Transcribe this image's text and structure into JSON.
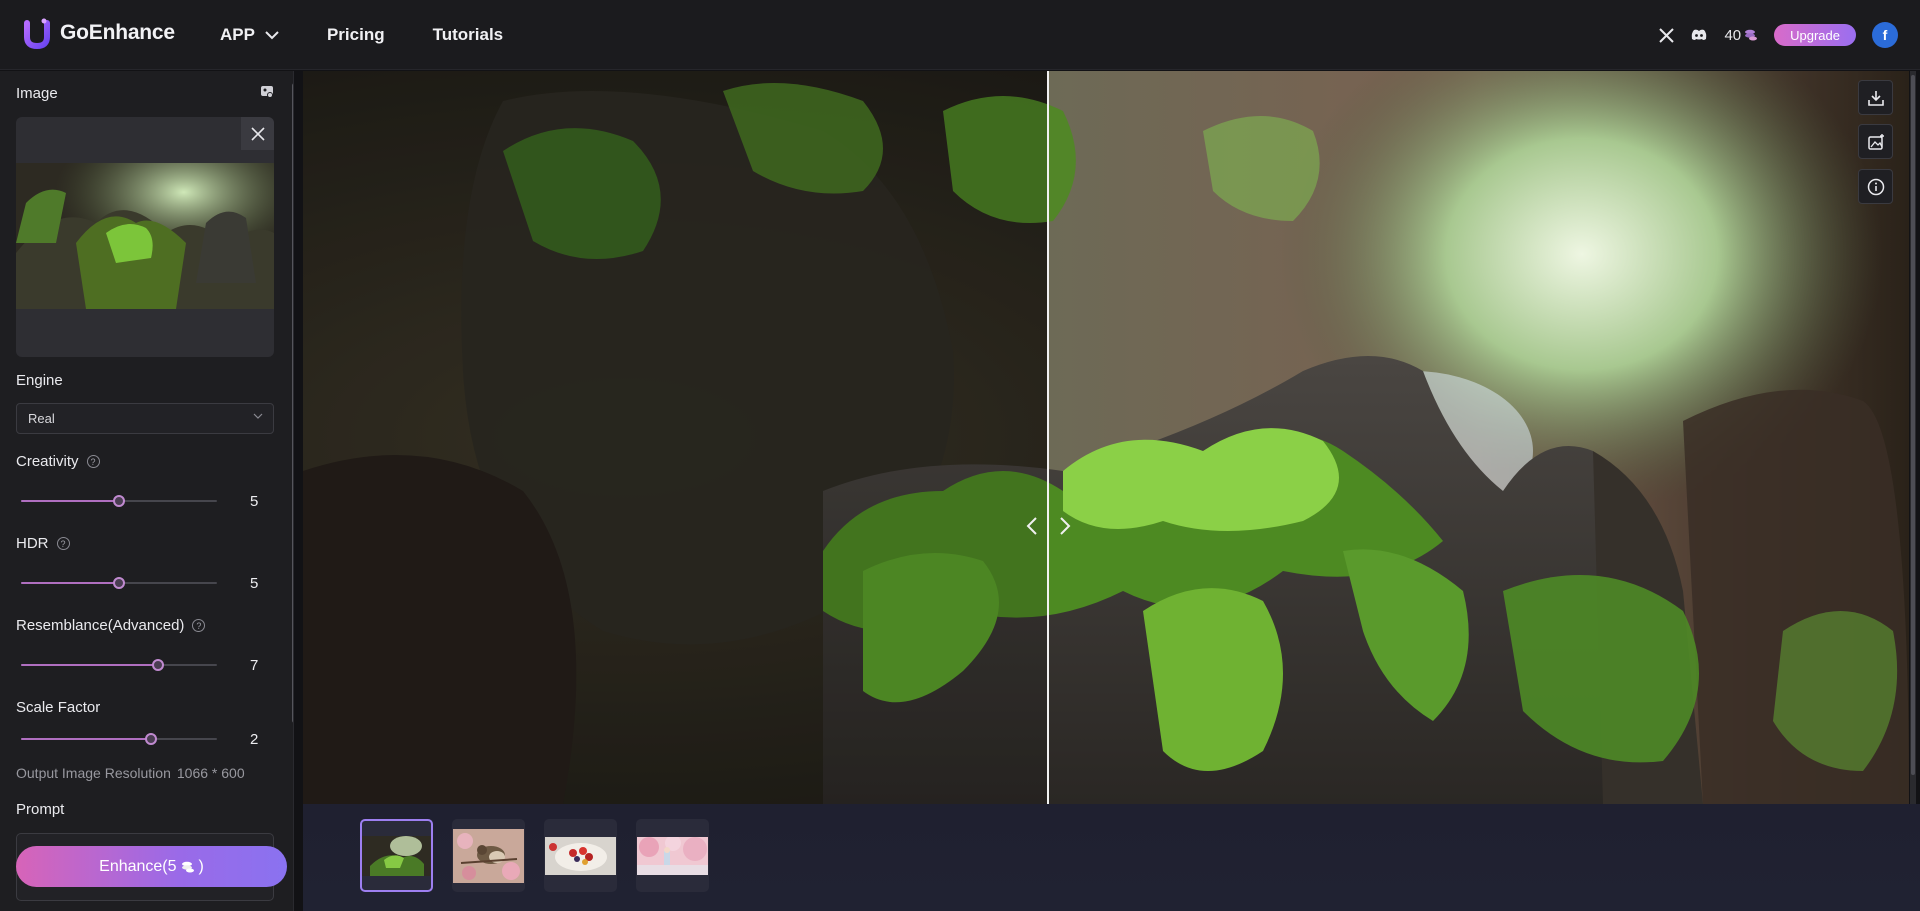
{
  "header": {
    "brand": "GoEnhance",
    "nav": [
      {
        "label": "APP"
      },
      {
        "label": "Pricing"
      },
      {
        "label": "Tutorials"
      }
    ],
    "credits": "40",
    "upgrade_label": "Upgrade",
    "avatar_letter": "f",
    "colors": {
      "brand_gradient_start": "#d86bc9",
      "brand_gradient_end": "#9a6ef0"
    }
  },
  "sidebar": {
    "image_label": "Image",
    "engine_label": "Engine",
    "engine_value": "Real",
    "creativity": {
      "label": "Creativity",
      "value": "5",
      "fraction": 0.5
    },
    "hdr": {
      "label": "HDR",
      "value": "5",
      "fraction": 0.5
    },
    "resemblance": {
      "label": "Resemblance(Advanced)",
      "value": "7",
      "fraction": 0.7
    },
    "scale": {
      "label": "Scale Factor",
      "value": "2",
      "fraction": 0.66
    },
    "output_label": "Output Image Resolution",
    "output_value": "1066 * 600",
    "prompt_label": "Prompt",
    "enhance_label": "Enhance(5",
    "enhance_suffix": ")"
  },
  "preview": {
    "tools": [
      "download-icon",
      "image-sparkle-icon",
      "info-icon"
    ]
  },
  "thumbnails": [
    {
      "name": "moss-rock",
      "active": true
    },
    {
      "name": "bird-blossoms",
      "active": false
    },
    {
      "name": "fruit-tart",
      "active": false
    },
    {
      "name": "pink-trees",
      "active": false
    }
  ]
}
